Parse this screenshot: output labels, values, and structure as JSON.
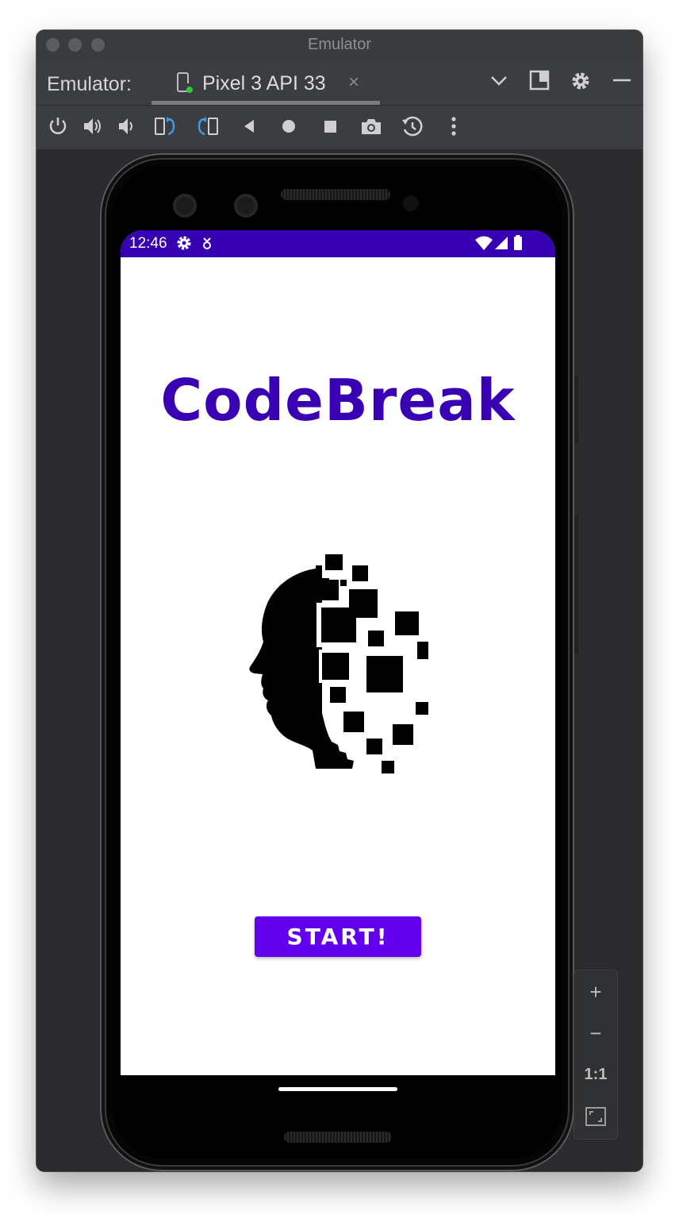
{
  "window": {
    "title": "Emulator"
  },
  "tabbar": {
    "prefix": "Emulator:",
    "tab_label": "Pixel 3 API 33",
    "tab_close": "×",
    "right_icons": [
      "chevron-down-icon",
      "layout-icon",
      "gear-icon",
      "minimize-icon"
    ]
  },
  "toolbar": {
    "icons": [
      "power-icon",
      "volume-up-icon",
      "volume-down-icon",
      "rotate-left-icon",
      "rotate-right-icon",
      "back-icon",
      "home-icon",
      "overview-icon",
      "camera-icon",
      "snapshot-icon",
      "more-icon"
    ]
  },
  "phone": {
    "status": {
      "time": "12:46",
      "left_icons": [
        "settings-icon",
        "download-icon"
      ],
      "right_icons": [
        "wifi-icon",
        "signal-icon",
        "battery-icon"
      ]
    },
    "app": {
      "title": "CodeBreak",
      "start_label": "START!",
      "logo": "head-pixels-logo"
    }
  },
  "zoom": {
    "in": "+",
    "out": "−",
    "actual": "1:1",
    "fit": "fit-screen-icon"
  },
  "colors": {
    "status_bar": "#3700b3",
    "title_text": "#3a00b4",
    "button": "#6200ee",
    "window_bg": "#2b2b2d"
  }
}
